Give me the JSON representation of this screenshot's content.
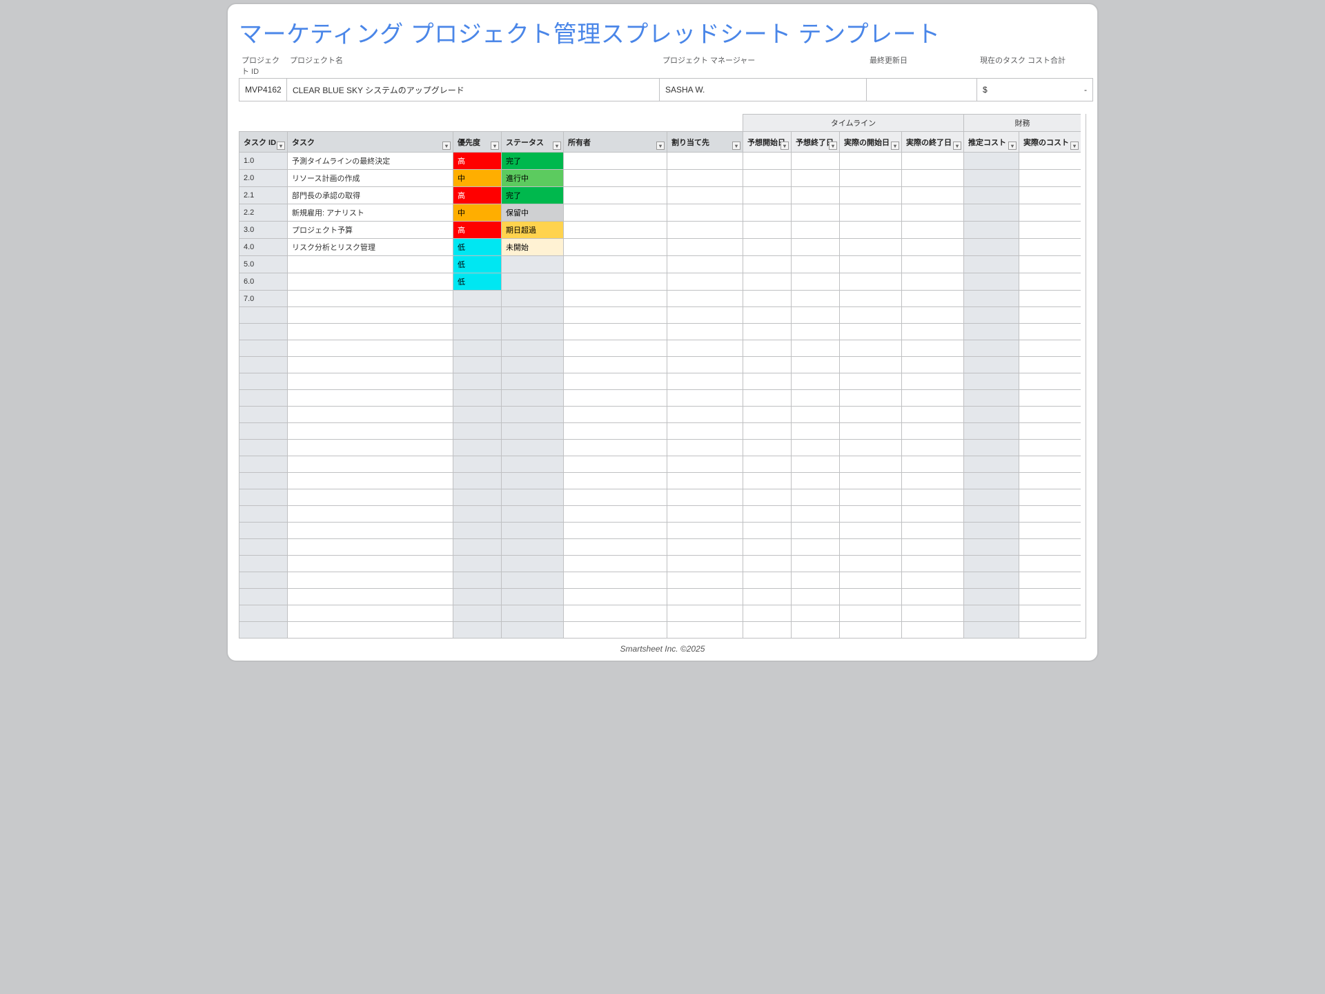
{
  "title": "マーケティング プロジェクト管理スプレッドシート テンプレート",
  "meta": {
    "labels": {
      "project_id": "プロジェクト ID",
      "project_name": "プロジェクト名",
      "project_manager": "プロジェクト マネージャー",
      "last_updated": "最終更新日",
      "total_cost": "現在のタスク コスト合計"
    },
    "values": {
      "project_id": "MVP4162",
      "project_name": "CLEAR BLUE SKY システムのアップグレード",
      "project_manager": "SASHA W.",
      "last_updated": "",
      "total_cost_prefix": "$",
      "total_cost_suffix": "-"
    }
  },
  "columns": {
    "task_id": "タスク ID",
    "task": "タスク",
    "priority": "優先度",
    "status": "ステータス",
    "owner": "所有者",
    "assigned": "割り当て先",
    "est_start": "予想開始日",
    "est_end": "予想終了日",
    "act_start": "実際の開始日",
    "act_end": "実際の終了日",
    "est_cost": "推定コスト",
    "act_cost": "実際のコスト"
  },
  "groups": {
    "timeline": "タイムライン",
    "finance": "財務"
  },
  "priority_labels": {
    "high": "高",
    "med": "中",
    "low": "低"
  },
  "status_labels": {
    "done": "完了",
    "prog": "進行中",
    "hold": "保留中",
    "over": "期日超過",
    "not": "未開始"
  },
  "rows": [
    {
      "id": "1.0",
      "task": "予測タイムラインの最終決定",
      "priority": "high",
      "status": "done"
    },
    {
      "id": "2.0",
      "task": "リソース計画の作成",
      "priority": "med",
      "status": "prog"
    },
    {
      "id": "2.1",
      "task": "部門長の承認の取得",
      "priority": "high",
      "status": "done"
    },
    {
      "id": "2.2",
      "task": "新規雇用: アナリスト",
      "priority": "med",
      "status": "hold"
    },
    {
      "id": "3.0",
      "task": "プロジェクト予算",
      "priority": "high",
      "status": "over"
    },
    {
      "id": "4.0",
      "task": "リスク分析とリスク管理",
      "priority": "low",
      "status": "not"
    },
    {
      "id": "5.0",
      "task": "",
      "priority": "low",
      "status": ""
    },
    {
      "id": "6.0",
      "task": "",
      "priority": "low",
      "status": ""
    },
    {
      "id": "7.0",
      "task": "",
      "priority": "",
      "status": ""
    }
  ],
  "empty_rows": 20,
  "footer": "Smartsheet Inc. ©2025"
}
